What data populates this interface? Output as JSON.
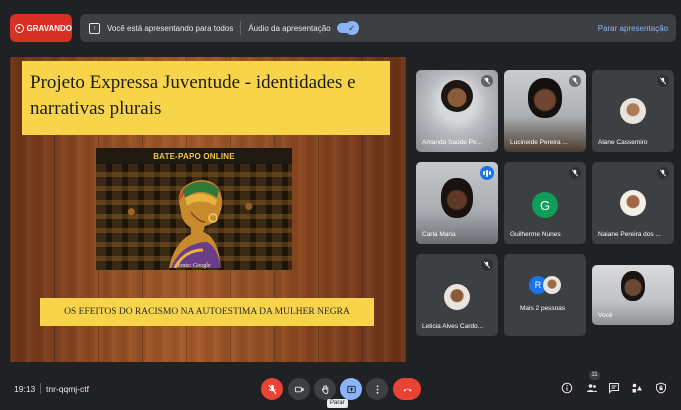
{
  "topbar": {
    "recording_label": "GRAVANDO",
    "presenting_text": "Você está apresentando para todos",
    "audio_label": "Áudio da apresentação",
    "stop_presenting": "Parar apresentação"
  },
  "slide": {
    "title": "Projeto Expressa Juventude - identidades e narrativas plurais",
    "poster_title": "BATE-PAPO ONLINE",
    "poster_credit": "fonte: Google",
    "banner": "OS EFEITOS  DO RACISMO NA AUTOESTIMA  DA MULHER NEGRA"
  },
  "participants": [
    {
      "name": "Amanda Saúde Pe...",
      "muted": true
    },
    {
      "name": "Lucineide Pereira ...",
      "muted": true
    },
    {
      "name": "Alane Cassemiro",
      "muted": true
    },
    {
      "name": "Carla Maria",
      "speaking": true
    },
    {
      "name": "Guilherme Nunes",
      "initial": "G",
      "muted": true
    },
    {
      "name": "Naiane Pereira dos ...",
      "muted": true
    },
    {
      "name": "Leticia Alves Cardo...",
      "muted": true
    },
    {
      "name": "Mais 2 pessoas",
      "initial": "R"
    },
    {
      "name": "Você"
    }
  ],
  "bottombar": {
    "time": "19:13",
    "meeting_code": "tnr-qqmj-ctf",
    "tooltip": "Parar",
    "people_count": "11"
  },
  "colors": {
    "record_red": "#d93025",
    "accent_blue": "#8ab4f8",
    "slide_yellow": "#f7d44a",
    "avatar_green": "#0f9d58"
  }
}
